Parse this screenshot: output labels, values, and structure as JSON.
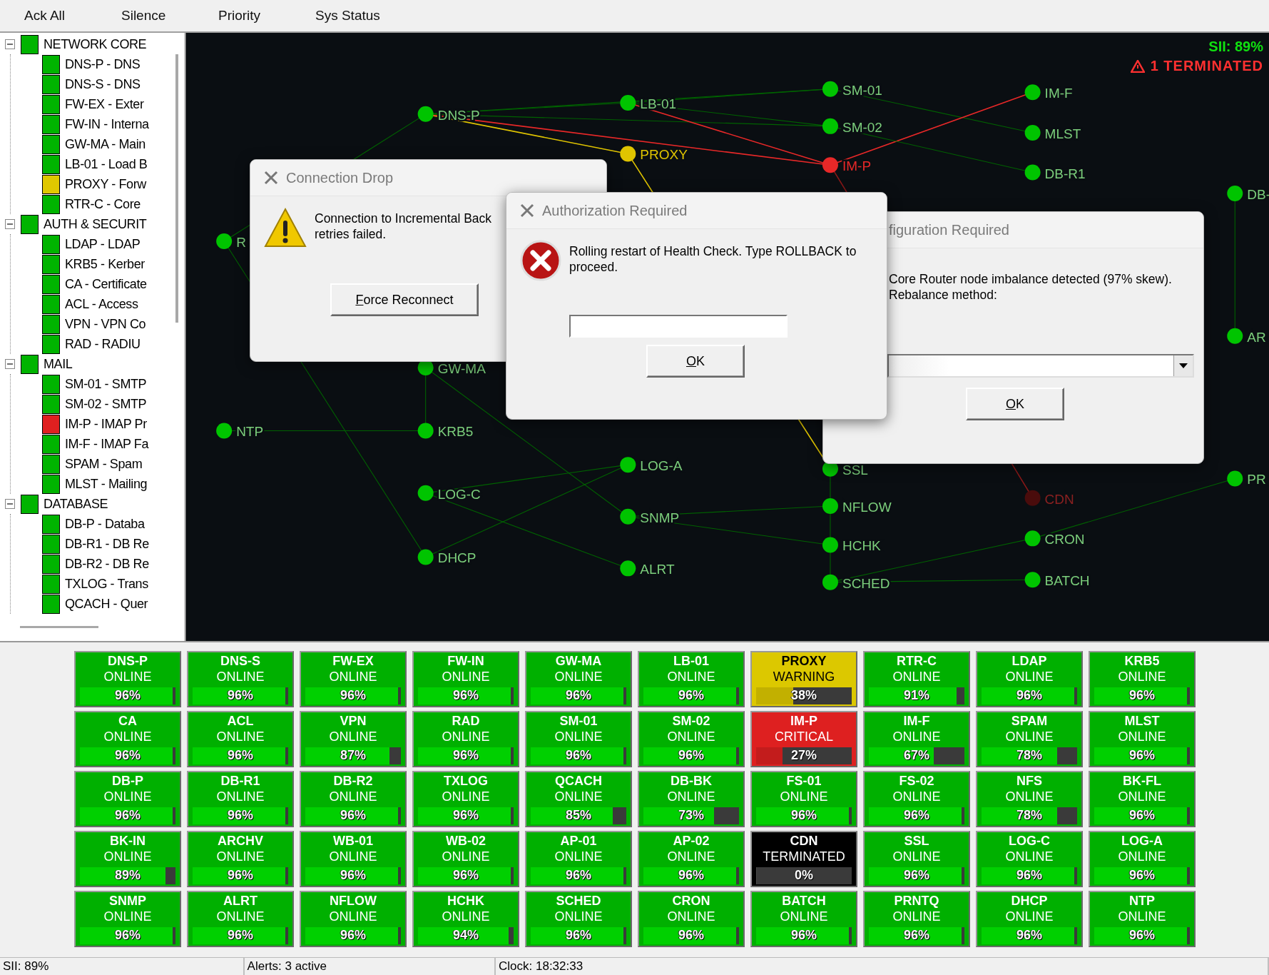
{
  "menu": [
    "Ack All",
    "Silence",
    "Priority",
    "Sys Status"
  ],
  "tree": [
    {
      "label": "NETWORK CORE",
      "color": "#00b400",
      "expanded": true,
      "children": [
        {
          "label": "DNS-P - DNS",
          "color": "#00b400"
        },
        {
          "label": "DNS-S - DNS",
          "color": "#00b400"
        },
        {
          "label": "FW-EX - Exter",
          "color": "#00b400"
        },
        {
          "label": "FW-IN - Interna",
          "color": "#00b400"
        },
        {
          "label": "GW-MA - Main",
          "color": "#00b400"
        },
        {
          "label": "LB-01 - Load B",
          "color": "#00b400"
        },
        {
          "label": "PROXY - Forw",
          "color": "#e0c800"
        },
        {
          "label": "RTR-C - Core",
          "color": "#00b400"
        }
      ]
    },
    {
      "label": "AUTH & SECURIT",
      "color": "#00b400",
      "expanded": true,
      "children": [
        {
          "label": "LDAP - LDAP",
          "color": "#00b400"
        },
        {
          "label": "KRB5 - Kerber",
          "color": "#00b400"
        },
        {
          "label": "CA - Certificate",
          "color": "#00b400"
        },
        {
          "label": "ACL - Access",
          "color": "#00b400"
        },
        {
          "label": "VPN - VPN Co",
          "color": "#00b400"
        },
        {
          "label": "RAD - RADIU",
          "color": "#00b400"
        }
      ]
    },
    {
      "label": "MAIL",
      "color": "#00b400",
      "expanded": true,
      "children": [
        {
          "label": "SM-01 - SMTP",
          "color": "#00b400"
        },
        {
          "label": "SM-02 - SMTP",
          "color": "#00b400"
        },
        {
          "label": "IM-P - IMAP Pr",
          "color": "#e02020"
        },
        {
          "label": "IM-F - IMAP Fa",
          "color": "#00b400"
        },
        {
          "label": "SPAM - Spam",
          "color": "#00b400"
        },
        {
          "label": "MLST - Mailing",
          "color": "#00b400"
        }
      ]
    },
    {
      "label": "DATABASE",
      "color": "#00b400",
      "expanded": true,
      "children": [
        {
          "label": "DB-P - Databa",
          "color": "#00b400"
        },
        {
          "label": "DB-R1 - DB Re",
          "color": "#00b400"
        },
        {
          "label": "DB-R2 - DB Re",
          "color": "#00b400"
        },
        {
          "label": "TXLOG - Trans",
          "color": "#00b400"
        },
        {
          "label": "QCACH - Quer",
          "color": "#00b400"
        }
      ]
    }
  ],
  "graph": {
    "sii": "SII: 89%",
    "alert": "1 TERMINATED",
    "nodes": [
      {
        "label": "DNS-P",
        "color": "#00c400"
      },
      {
        "label": "LB-01",
        "color": "#00c400"
      },
      {
        "label": "PROXY",
        "color": "#e0c400"
      },
      {
        "label": "SM-01",
        "color": "#00c400"
      },
      {
        "label": "SM-02",
        "color": "#00c400"
      },
      {
        "label": "IM-P",
        "color": "#e82828"
      },
      {
        "label": "IM-F",
        "color": "#00c400"
      },
      {
        "label": "MLST",
        "color": "#00c400"
      },
      {
        "label": "DB-R1",
        "color": "#00c400"
      },
      {
        "label": "DB-",
        "color": "#00c400"
      },
      {
        "label": "R",
        "color": "#00c400"
      },
      {
        "label": "AR",
        "color": "#00c400"
      },
      {
        "label": "GW-MA",
        "color": "#00c400"
      },
      {
        "label": "NTP",
        "color": "#00c400"
      },
      {
        "label": "KRB5",
        "color": "#00c400"
      },
      {
        "label": "LOG-A",
        "color": "#00c400"
      },
      {
        "label": "LOG-C",
        "color": "#00c400"
      },
      {
        "label": "SNMP",
        "color": "#00c400"
      },
      {
        "label": "DHCP",
        "color": "#00c400"
      },
      {
        "label": "ALRT",
        "color": "#00c400"
      },
      {
        "label": "SSL",
        "color": "#00c400"
      },
      {
        "label": "NFLOW",
        "color": "#00c400"
      },
      {
        "label": "HCHK",
        "color": "#00c400"
      },
      {
        "label": "SCHED",
        "color": "#00c400"
      },
      {
        "label": "CDN",
        "color": "#4a0c0c"
      },
      {
        "label": "CRON",
        "color": "#00c400"
      },
      {
        "label": "BATCH",
        "color": "#00c400"
      },
      {
        "label": "PR",
        "color": "#00c400"
      }
    ]
  },
  "dialogs": [
    {
      "kind": "warning",
      "title": "Connection Drop",
      "message": [
        "Connection to Incremental Back",
        "retries failed."
      ],
      "button": "Force Reconnect"
    },
    {
      "kind": "input",
      "title": "Authorization Required",
      "message": [
        "Rolling restart of Health Check. Type ROLLBACK to",
        "proceed."
      ],
      "button": "OK"
    },
    {
      "kind": "select",
      "title": "figuration Required",
      "message": [
        "Core Router node imbalance detected (97% skew).",
        "Rebalance method:"
      ],
      "button": "OK"
    }
  ],
  "tiles": [
    {
      "name": "DNS-P",
      "state": "ONLINE",
      "color": "#00b000",
      "percent": "96%",
      "level": 0.96
    },
    {
      "name": "DNS-S",
      "state": "ONLINE",
      "color": "#00b000",
      "percent": "96%",
      "level": 0.96
    },
    {
      "name": "FW-EX",
      "state": "ONLINE",
      "color": "#00b000",
      "percent": "96%",
      "level": 0.96
    },
    {
      "name": "FW-IN",
      "state": "ONLINE",
      "color": "#00b000",
      "percent": "96%",
      "level": 0.96
    },
    {
      "name": "GW-MA",
      "state": "ONLINE",
      "color": "#00b000",
      "percent": "96%",
      "level": 0.96
    },
    {
      "name": "LB-01",
      "state": "ONLINE",
      "color": "#00b000",
      "percent": "96%",
      "level": 0.96
    },
    {
      "name": "PROXY",
      "state": "WARNING",
      "color": "#dcc800",
      "percent": "38%",
      "level": 0.38
    },
    {
      "name": "RTR-C",
      "state": "ONLINE",
      "color": "#00b000",
      "percent": "91%",
      "level": 0.91
    },
    {
      "name": "LDAP",
      "state": "ONLINE",
      "color": "#00b000",
      "percent": "96%",
      "level": 0.96
    },
    {
      "name": "KRB5",
      "state": "ONLINE",
      "color": "#00b000",
      "percent": "96%",
      "level": 0.96
    },
    {
      "name": "CA",
      "state": "ONLINE",
      "color": "#00b000",
      "percent": "96%",
      "level": 0.96
    },
    {
      "name": "ACL",
      "state": "ONLINE",
      "color": "#00b000",
      "percent": "96%",
      "level": 0.96
    },
    {
      "name": "VPN",
      "state": "ONLINE",
      "color": "#00b000",
      "percent": "87%",
      "level": 0.87
    },
    {
      "name": "RAD",
      "state": "ONLINE",
      "color": "#00b000",
      "percent": "96%",
      "level": 0.96
    },
    {
      "name": "SM-01",
      "state": "ONLINE",
      "color": "#00b000",
      "percent": "96%",
      "level": 0.96
    },
    {
      "name": "SM-02",
      "state": "ONLINE",
      "color": "#00b000",
      "percent": "96%",
      "level": 0.96
    },
    {
      "name": "IM-P",
      "state": "CRITICAL",
      "color": "#de2020",
      "percent": "27%",
      "level": 0.27
    },
    {
      "name": "IM-F",
      "state": "ONLINE",
      "color": "#00b000",
      "percent": "67%",
      "level": 0.67
    },
    {
      "name": "SPAM",
      "state": "ONLINE",
      "color": "#00b000",
      "percent": "78%",
      "level": 0.78
    },
    {
      "name": "MLST",
      "state": "ONLINE",
      "color": "#00b000",
      "percent": "96%",
      "level": 0.96
    },
    {
      "name": "DB-P",
      "state": "ONLINE",
      "color": "#00b000",
      "percent": "96%",
      "level": 0.96
    },
    {
      "name": "DB-R1",
      "state": "ONLINE",
      "color": "#00b000",
      "percent": "96%",
      "level": 0.96
    },
    {
      "name": "DB-R2",
      "state": "ONLINE",
      "color": "#00b000",
      "percent": "96%",
      "level": 0.96
    },
    {
      "name": "TXLOG",
      "state": "ONLINE",
      "color": "#00b000",
      "percent": "96%",
      "level": 0.96
    },
    {
      "name": "QCACH",
      "state": "ONLINE",
      "color": "#00b000",
      "percent": "85%",
      "level": 0.85
    },
    {
      "name": "DB-BK",
      "state": "ONLINE",
      "color": "#00b000",
      "percent": "73%",
      "level": 0.73
    },
    {
      "name": "FS-01",
      "state": "ONLINE",
      "color": "#00b000",
      "percent": "96%",
      "level": 0.96
    },
    {
      "name": "FS-02",
      "state": "ONLINE",
      "color": "#00b000",
      "percent": "96%",
      "level": 0.96
    },
    {
      "name": "NFS",
      "state": "ONLINE",
      "color": "#00b000",
      "percent": "78%",
      "level": 0.78
    },
    {
      "name": "BK-FL",
      "state": "ONLINE",
      "color": "#00b000",
      "percent": "96%",
      "level": 0.96
    },
    {
      "name": "BK-IN",
      "state": "ONLINE",
      "color": "#00b000",
      "percent": "89%",
      "level": 0.89
    },
    {
      "name": "ARCHV",
      "state": "ONLINE",
      "color": "#00b000",
      "percent": "96%",
      "level": 0.96
    },
    {
      "name": "WB-01",
      "state": "ONLINE",
      "color": "#00b000",
      "percent": "96%",
      "level": 0.96
    },
    {
      "name": "WB-02",
      "state": "ONLINE",
      "color": "#00b000",
      "percent": "96%",
      "level": 0.96
    },
    {
      "name": "AP-01",
      "state": "ONLINE",
      "color": "#00b000",
      "percent": "96%",
      "level": 0.96
    },
    {
      "name": "AP-02",
      "state": "ONLINE",
      "color": "#00b000",
      "percent": "96%",
      "level": 0.96
    },
    {
      "name": "CDN",
      "state": "TERMINATED",
      "color": "#000000",
      "percent": "0%",
      "level": 0
    },
    {
      "name": "SSL",
      "state": "ONLINE",
      "color": "#00b000",
      "percent": "96%",
      "level": 0.96
    },
    {
      "name": "LOG-C",
      "state": "ONLINE",
      "color": "#00b000",
      "percent": "96%",
      "level": 0.96
    },
    {
      "name": "LOG-A",
      "state": "ONLINE",
      "color": "#00b000",
      "percent": "96%",
      "level": 0.96
    },
    {
      "name": "SNMP",
      "state": "ONLINE",
      "color": "#00b000",
      "percent": "96%",
      "level": 0.96
    },
    {
      "name": "ALRT",
      "state": "ONLINE",
      "color": "#00b000",
      "percent": "96%",
      "level": 0.96
    },
    {
      "name": "NFLOW",
      "state": "ONLINE",
      "color": "#00b000",
      "percent": "96%",
      "level": 0.96
    },
    {
      "name": "HCHK",
      "state": "ONLINE",
      "color": "#00b000",
      "percent": "94%",
      "level": 0.94
    },
    {
      "name": "SCHED",
      "state": "ONLINE",
      "color": "#00b000",
      "percent": "96%",
      "level": 0.96
    },
    {
      "name": "CRON",
      "state": "ONLINE",
      "color": "#00b000",
      "percent": "96%",
      "level": 0.96
    },
    {
      "name": "BATCH",
      "state": "ONLINE",
      "color": "#00b000",
      "percent": "96%",
      "level": 0.96
    },
    {
      "name": "PRNTQ",
      "state": "ONLINE",
      "color": "#00b000",
      "percent": "96%",
      "level": 0.96
    },
    {
      "name": "DHCP",
      "state": "ONLINE",
      "color": "#00b000",
      "percent": "96%",
      "level": 0.96
    },
    {
      "name": "NTP",
      "state": "ONLINE",
      "color": "#00b000",
      "percent": "96%",
      "level": 0.96
    }
  ],
  "status_bar": [
    "SII: 89%",
    "Alerts: 3 active",
    "Clock: 18:32:33"
  ]
}
